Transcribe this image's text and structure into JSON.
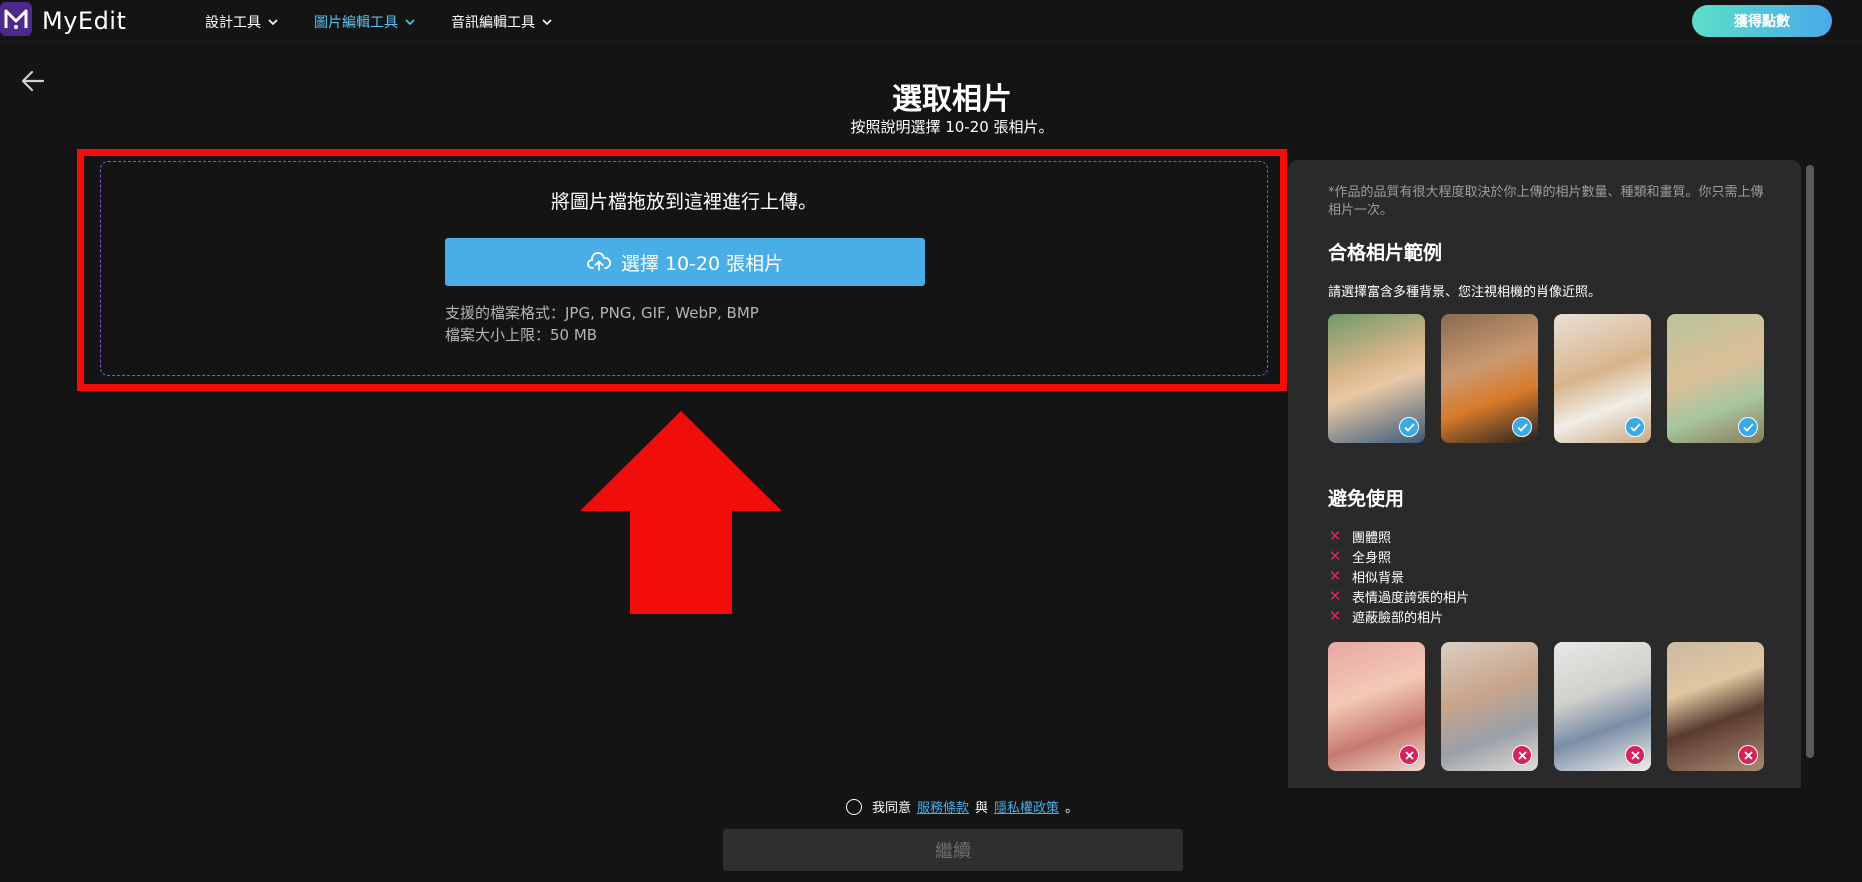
{
  "app": {
    "name": "MyEdit"
  },
  "nav": {
    "items": [
      {
        "label": "設計工具",
        "active": false
      },
      {
        "label": "圖片編輯工具",
        "active": true
      },
      {
        "label": "音訊編輯工具",
        "active": false
      }
    ],
    "points_label": "獲得點數"
  },
  "page": {
    "title": "選取相片",
    "subtitle": "按照說明選擇 10-20 張相片。"
  },
  "upload": {
    "drop_text": "將圖片檔拖放到這裡進行上傳。",
    "select_label": "選擇 10-20 張相片",
    "formats": "支援的檔案格式：JPG, PNG, GIF, WebP, BMP",
    "size_limit": "檔案大小上限：50 MB"
  },
  "side": {
    "note": "*作品的品質有很大程度取決於你上傳的相片數量、種類和畫質。你只需上傳相片一次。",
    "good_title": "合格相片範例",
    "good_desc": "請選擇富含多種背景、您注視相機的肖像近照。",
    "avoid_title": "避免使用",
    "avoid_items": [
      "團體照",
      "全身照",
      "相似背景",
      "表情過度誇張的相片",
      "遮蔽臉部的相片"
    ]
  },
  "agreement": {
    "prefix": "我同意",
    "terms": "服務條款",
    "joiner": "與",
    "privacy": "隱私權政策",
    "suffix": "。"
  },
  "continue_label": "繼續",
  "colors": {
    "accent": "#4aaee6",
    "highlight_red": "#f20d0d",
    "avoid_red": "#e0236a"
  }
}
